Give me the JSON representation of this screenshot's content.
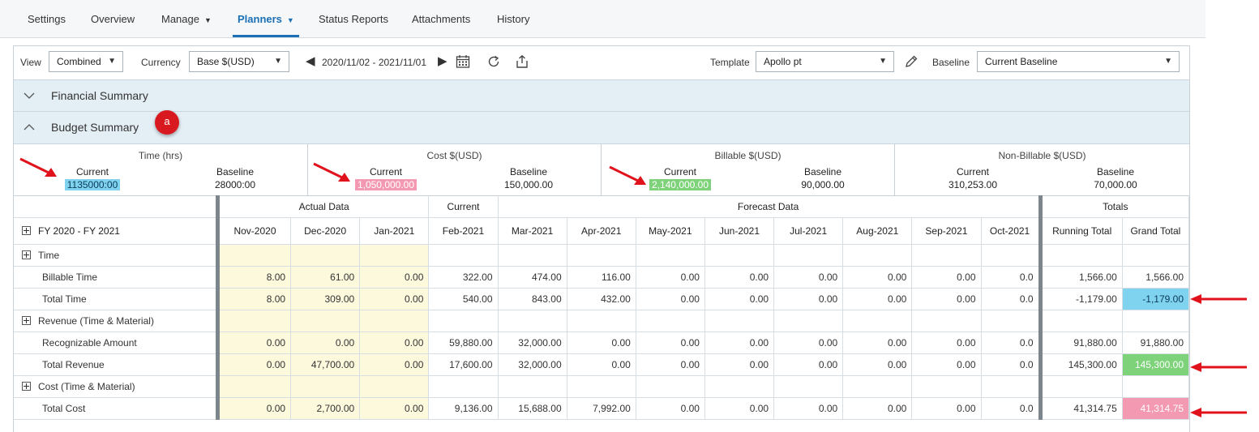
{
  "tabs": [
    {
      "label": "Settings"
    },
    {
      "label": "Overview"
    },
    {
      "label": "Manage"
    },
    {
      "label": "Planners"
    },
    {
      "label": "Status Reports"
    },
    {
      "label": "Attachments"
    },
    {
      "label": "History"
    }
  ],
  "toolbar": {
    "view_label": "View",
    "view_value": "Combined",
    "currency_label": "Currency",
    "currency_value": "Base $(USD)",
    "date_range": "2020/11/02 - 2021/11/01",
    "template_label": "Template",
    "template_value": "Apollo pt",
    "baseline_label": "Baseline",
    "baseline_value": "Current Baseline"
  },
  "sections": {
    "financial": "Financial Summary",
    "budget": "Budget Summary",
    "badge": "a"
  },
  "cards": [
    {
      "title": "Time (hrs)",
      "current_label": "Current",
      "current": "1135000:00",
      "baseline_label": "Baseline",
      "baseline": "28000:00"
    },
    {
      "title": "Cost $(USD)",
      "current_label": "Current",
      "current": "1,050,000.00",
      "baseline_label": "Baseline",
      "baseline": "150,000.00"
    },
    {
      "title": "Billable $(USD)",
      "current_label": "Current",
      "current": "2,140,000.00",
      "baseline_label": "Baseline",
      "baseline": "90,000.00"
    },
    {
      "title": "Non-Billable $(USD)",
      "current_label": "Current",
      "current": "310,253.00",
      "baseline_label": "Baseline",
      "baseline": "70,000.00"
    }
  ],
  "grid": {
    "fiscal_label": "FY 2020 - FY 2021",
    "groups": {
      "actual": "Actual Data",
      "current": "Current",
      "forecast": "Forecast Data",
      "totals": "Totals"
    },
    "months": [
      "Nov-2020",
      "Dec-2020",
      "Jan-2021",
      "Feb-2021",
      "Mar-2021",
      "Apr-2021",
      "May-2021",
      "Jun-2021",
      "Jul-2021",
      "Aug-2021",
      "Sep-2021",
      "Oct-2021"
    ],
    "total_cols": [
      "Running Total",
      "Grand Total"
    ],
    "rows": [
      {
        "label": "Time",
        "expand": true,
        "values": []
      },
      {
        "label": "Billable Time",
        "values": [
          "8.00",
          "61.00",
          "0.00",
          "322.00",
          "474.00",
          "116.00",
          "0.00",
          "0.00",
          "0.00",
          "0.00",
          "0.00",
          "0.0",
          "1,566.00",
          "1,566.00"
        ]
      },
      {
        "label": "Total Time",
        "values": [
          "8.00",
          "309.00",
          "0.00",
          "540.00",
          "843.00",
          "432.00",
          "0.00",
          "0.00",
          "0.00",
          "0.00",
          "0.00",
          "0.0",
          "-1,179.00",
          "-1,179.00"
        ],
        "highlight": "blue"
      },
      {
        "label": "Revenue (Time & Material)",
        "expand": true,
        "values": []
      },
      {
        "label": "Recognizable Amount",
        "values": [
          "0.00",
          "0.00",
          "0.00",
          "59,880.00",
          "32,000.00",
          "0.00",
          "0.00",
          "0.00",
          "0.00",
          "0.00",
          "0.00",
          "0.0",
          "91,880.00",
          "91,880.00"
        ]
      },
      {
        "label": "Total Revenue",
        "values": [
          "0.00",
          "47,700.00",
          "0.00",
          "17,600.00",
          "32,000.00",
          "0.00",
          "0.00",
          "0.00",
          "0.00",
          "0.00",
          "0.00",
          "0.0",
          "145,300.00",
          "145,300.00"
        ],
        "highlight": "green"
      },
      {
        "label": "Cost (Time & Material)",
        "expand": true,
        "values": []
      },
      {
        "label": "Total Cost",
        "values": [
          "0.00",
          "2,700.00",
          "0.00",
          "9,136.00",
          "15,688.00",
          "7,992.00",
          "0.00",
          "0.00",
          "0.00",
          "0.00",
          "0.00",
          "0.0",
          "41,314.75",
          "41,314.75"
        ],
        "highlight": "pink"
      }
    ]
  },
  "colors": {
    "accent": "#1a6fb5",
    "arrow": "#e0121b",
    "highlight_blue": "#7fd3ef",
    "highlight_pink": "#f39ab2",
    "highlight_green": "#7ed27a"
  }
}
